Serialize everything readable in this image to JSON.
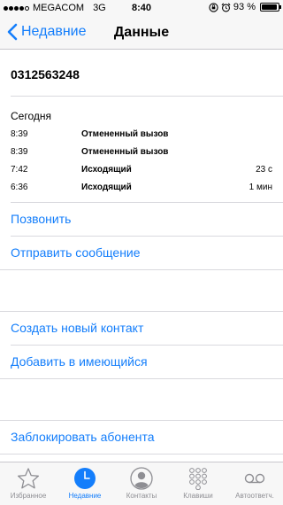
{
  "status_bar": {
    "carrier": "MEGACOM",
    "network": "3G",
    "time": "8:40",
    "battery_text": "93 %",
    "battery_level": 0.93
  },
  "nav": {
    "back_label": "Недавние",
    "title": "Данные"
  },
  "contact": {
    "phone_number": "0312563248"
  },
  "history": {
    "day": "Сегодня",
    "calls": [
      {
        "time": "8:39",
        "type": "Отмененный вызов",
        "duration": ""
      },
      {
        "time": "8:39",
        "type": "Отмененный вызов",
        "duration": ""
      },
      {
        "time": "7:42",
        "type": "Исходящий",
        "duration": "23 с"
      },
      {
        "time": "6:36",
        "type": "Исходящий",
        "duration": "1 мин"
      }
    ]
  },
  "actions": {
    "call": "Позвонить",
    "message": "Отправить сообщение",
    "new_contact": "Создать новый контакт",
    "add_existing": "Добавить в имеющийся",
    "block": "Заблокировать абонента"
  },
  "tabs": [
    {
      "label": "Избранное",
      "icon": "star-icon"
    },
    {
      "label": "Недавние",
      "icon": "clock-icon",
      "active": true
    },
    {
      "label": "Контакты",
      "icon": "contacts-icon"
    },
    {
      "label": "Клавиши",
      "icon": "keypad-icon"
    },
    {
      "label": "Автоответч.",
      "icon": "voicemail-icon"
    }
  ],
  "colors": {
    "accent": "#147efb",
    "inactive": "#8e8e93"
  }
}
